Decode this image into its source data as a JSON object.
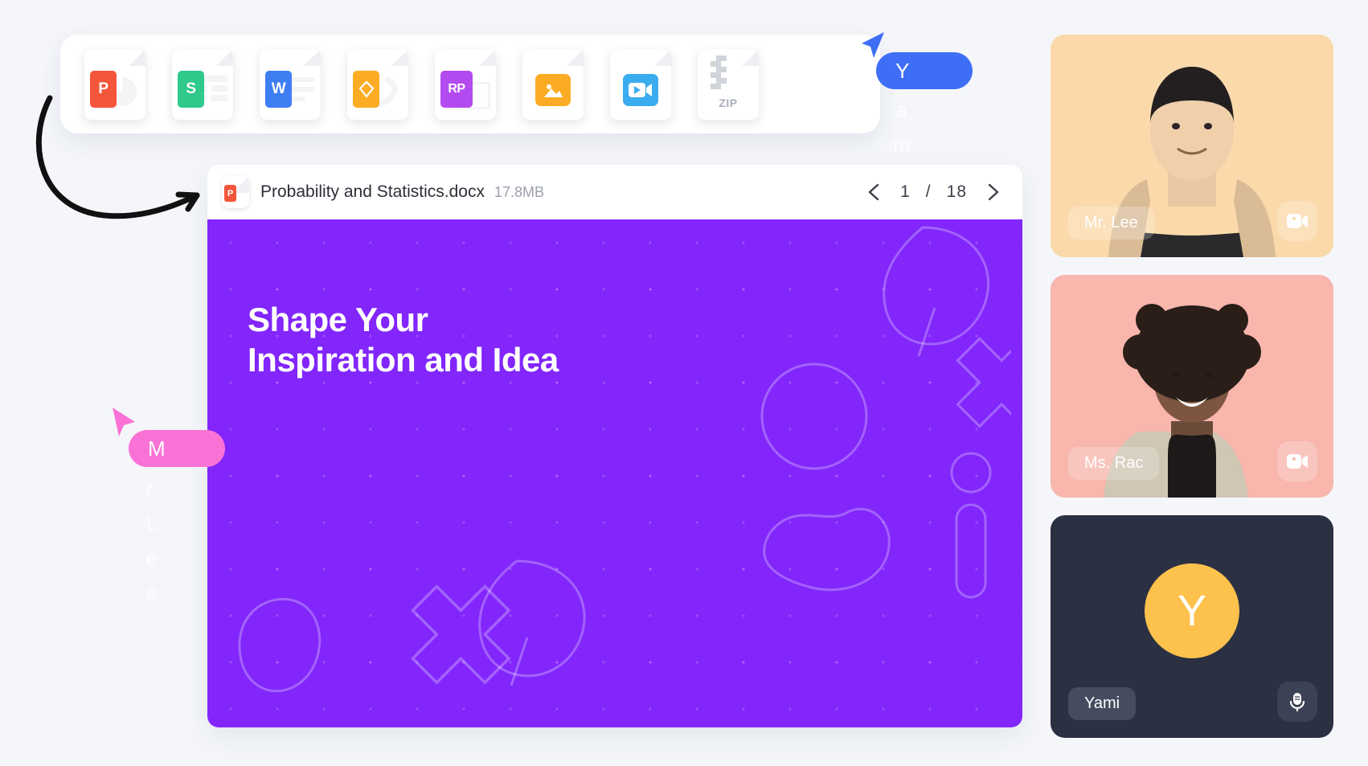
{
  "filebar": {
    "items": [
      {
        "name": "powerpoint-file-icon",
        "label": "P",
        "color": "#f4563c",
        "kind": "badge"
      },
      {
        "name": "spreadsheet-file-icon",
        "label": "S",
        "color": "#2fc98a",
        "kind": "badge"
      },
      {
        "name": "word-file-icon",
        "label": "W",
        "color": "#3d7ef3",
        "kind": "badge"
      },
      {
        "name": "sketch-file-icon",
        "label": "",
        "color": "#fcac24",
        "kind": "pen"
      },
      {
        "name": "rp-file-icon",
        "label": "RP",
        "color": "#b44bf0",
        "kind": "badge-wide"
      },
      {
        "name": "image-file-icon",
        "label": "",
        "color": "#fcac24",
        "kind": "image"
      },
      {
        "name": "video-file-icon",
        "label": "",
        "color": "#3cacf0",
        "kind": "video"
      },
      {
        "name": "zip-file-icon",
        "label": "ZIP",
        "color": "#c4c9d1",
        "kind": "zip"
      }
    ]
  },
  "viewer": {
    "file_name": "Probability and Statistics.docx",
    "file_size": "17.8MB",
    "current_page": "1",
    "page_separator": "/",
    "total_pages": "18",
    "prev_label": "Previous page",
    "next_label": "Next page"
  },
  "slide": {
    "title": "Shape Your\nInspiration and Idea",
    "background_color": "#8226fb"
  },
  "participants": [
    {
      "name": "Mr. Lee",
      "tile_color": "#fbd9ab",
      "media_icon": "video-camera-icon",
      "type": "video"
    },
    {
      "name": "Ms. Rac",
      "tile_color": "#f8b6ad",
      "media_icon": "video-camera-icon",
      "type": "video"
    },
    {
      "name": "Yami",
      "tile_color": "#2b3042",
      "media_icon": "microphone-icon",
      "type": "avatar",
      "avatar_initial": "Y",
      "avatar_color": "#fdc24d"
    }
  ],
  "cursors": [
    {
      "initial": "Y",
      "trail": "a\nm\ni",
      "color": "#3f6ef6",
      "full_name": "Yami"
    },
    {
      "initial": "M",
      "trail": "r.\nL\ne\ne",
      "color": "#fb72d6",
      "full_name": "Mr. Lee"
    }
  ]
}
